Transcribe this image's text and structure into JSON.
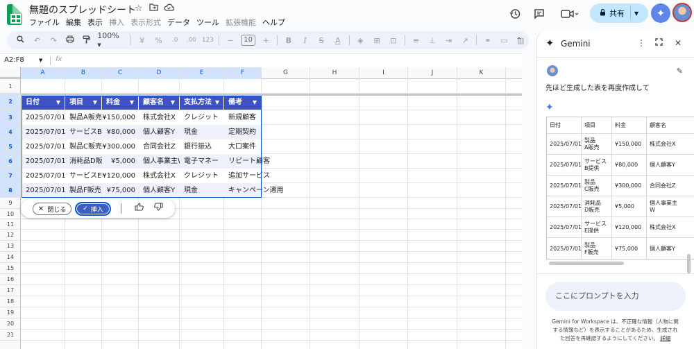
{
  "header": {
    "title": "無題のスプレッドシート",
    "menus": [
      {
        "label": "ファイル",
        "dim": false
      },
      {
        "label": "編集",
        "dim": false
      },
      {
        "label": "表示",
        "dim": false
      },
      {
        "label": "挿入",
        "dim": true
      },
      {
        "label": "表示形式",
        "dim": true
      },
      {
        "label": "データ",
        "dim": false
      },
      {
        "label": "ツール",
        "dim": false
      },
      {
        "label": "拡張機能",
        "dim": true
      },
      {
        "label": "ヘルプ",
        "dim": false
      }
    ],
    "share_label": "共有"
  },
  "toolbar": {
    "zoom": "100%",
    "font_size": "10",
    "currency": "¥",
    "percent": "%",
    "dec_minus": ".0",
    "dec_plus": ".00",
    "number_format": "123"
  },
  "formula_bar": {
    "name_box": "A2:F8",
    "fx": "fx"
  },
  "grid": {
    "columns": [
      "A",
      "B",
      "C",
      "D",
      "E",
      "F",
      "G",
      "H",
      "I",
      "J",
      "K"
    ],
    "selected_columns": [
      "A",
      "B",
      "C",
      "D",
      "E",
      "F"
    ],
    "rows": [
      "1",
      "2",
      "3",
      "4",
      "5",
      "6",
      "7",
      "8",
      "9",
      "10",
      "11",
      "12",
      "13",
      "14",
      "15",
      "16",
      "17",
      "18",
      "19",
      "20",
      "21"
    ],
    "selected_rows": [
      "2",
      "3",
      "4",
      "5",
      "6",
      "7",
      "8"
    ]
  },
  "table": {
    "headers": [
      "日付",
      "項目",
      "料金",
      "顧客名",
      "支払方法",
      "備考"
    ],
    "rows": [
      [
        "2025/07/01",
        "製品A販売",
        "¥150,000",
        "株式会社X",
        "クレジット",
        "新規顧客"
      ],
      [
        "2025/07/01",
        "サービスB提",
        "¥80,000",
        "個人顧客Y",
        "現金",
        "定期契約"
      ],
      [
        "2025/07/01",
        "製品C販売",
        "¥300,000",
        "合同会社Z",
        "銀行振込",
        "大口案件"
      ],
      [
        "2025/07/01",
        "消耗品D販売",
        "¥5,000",
        "個人事業主W",
        "電子マネー",
        "リピート顧客"
      ],
      [
        "2025/07/01",
        "サービスE提",
        "¥120,000",
        "株式会社X",
        "クレジット",
        "追加サービス"
      ],
      [
        "2025/07/01",
        "製品F販売",
        "¥75,000",
        "個人顧客Y",
        "現金",
        "キャンペーン適用"
      ]
    ]
  },
  "insert_bar": {
    "close_label": "閉じる",
    "insert_label": "挿入"
  },
  "gemini": {
    "title": "Gemini",
    "user_prompt": "先ほど生成した表を再度作成して",
    "table_headers": [
      "日付",
      "項目",
      "料金",
      "顧客名"
    ],
    "table_rows": [
      [
        "2025/07/01",
        "製品\nA販売",
        "¥150,000",
        "株式会社X"
      ],
      [
        "2025/07/01",
        "サービス\nB提供",
        "¥80,000",
        "個人顧客Y"
      ],
      [
        "2025/07/01",
        "製品\nC販売",
        "¥300,000",
        "合同会社Z"
      ],
      [
        "2025/07/01",
        "消耗品\nD販売",
        "¥5,000",
        "個人事業主\nW"
      ],
      [
        "2025/07/01",
        "サービス\nE提供",
        "¥120,000",
        "株式会社X"
      ],
      [
        "2025/07/01",
        "製品\nF販売",
        "¥75,000",
        "個人顧客Y"
      ]
    ],
    "input_placeholder": "ここにプロンプトを入力",
    "disclaimer": "Gemini for Workspace は、不正確な情報（人物に関する情報など）を表示することがあるため、生成された回答を再確認するようにしてください。",
    "disclaimer_link": "詳細"
  },
  "icons": {
    "history": "history-icon",
    "comment": "comment-icon",
    "meet": "video-icon",
    "lock": "lock-icon"
  }
}
